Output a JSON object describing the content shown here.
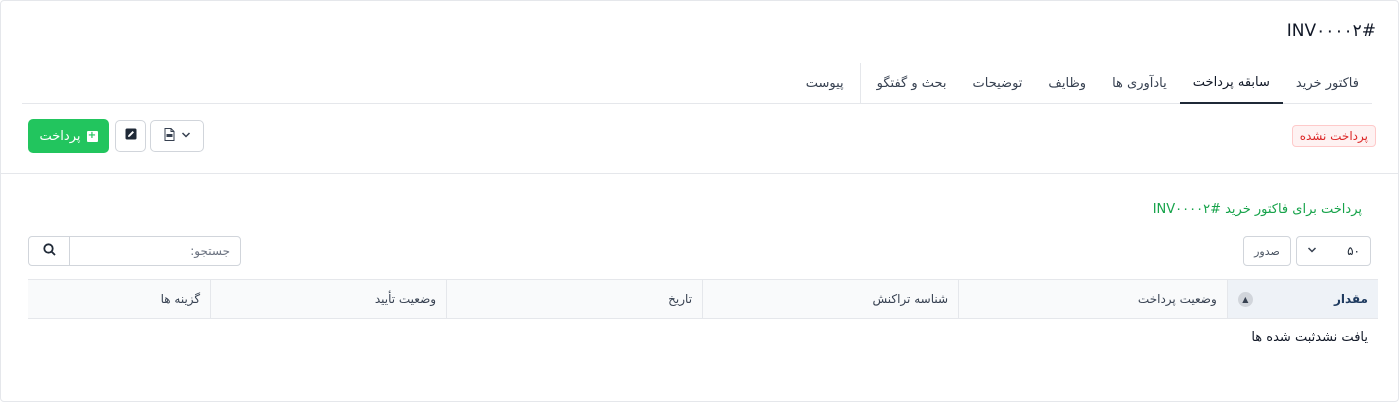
{
  "invoice": {
    "title": "INV۰۰۰۰۲#"
  },
  "tabs": [
    {
      "label": "فاکتور خرید",
      "active": false
    },
    {
      "label": "سابقه پرداخت",
      "active": true
    },
    {
      "label": "یادآوری ها",
      "active": false
    },
    {
      "label": "وظایف",
      "active": false
    },
    {
      "label": "توضیحات",
      "active": false
    },
    {
      "label": "بحث و گفتگو",
      "active": false
    },
    {
      "label": "پیوست",
      "active": false
    }
  ],
  "status": {
    "label": "پرداخت نشده",
    "color": "#dc2626"
  },
  "toolbar": {
    "pay_label": "پرداخت",
    "pay_icon": "plus-square-icon",
    "edit_icon": "edit-icon",
    "pdf_icon": "pdf-file-icon",
    "dropdown_icon": "chevron-down-icon",
    "accent": "#22c55e"
  },
  "section": {
    "title": "پرداخت برای فاکتور خرید #INV۰۰۰۰۲"
  },
  "table_controls": {
    "page_length": "۵۰",
    "export_label": "صدور",
    "search_placeholder": "جستجو:",
    "search_icon": "search-icon"
  },
  "table": {
    "columns": [
      "مقدار",
      "وضعیت پرداخت",
      "شناسه تراکنش",
      "تاریخ",
      "وضعیت تأیید",
      "گزینه ها"
    ],
    "sorted_column": "مقدار",
    "empty_message": "یافت نشدثبت شده ها"
  }
}
